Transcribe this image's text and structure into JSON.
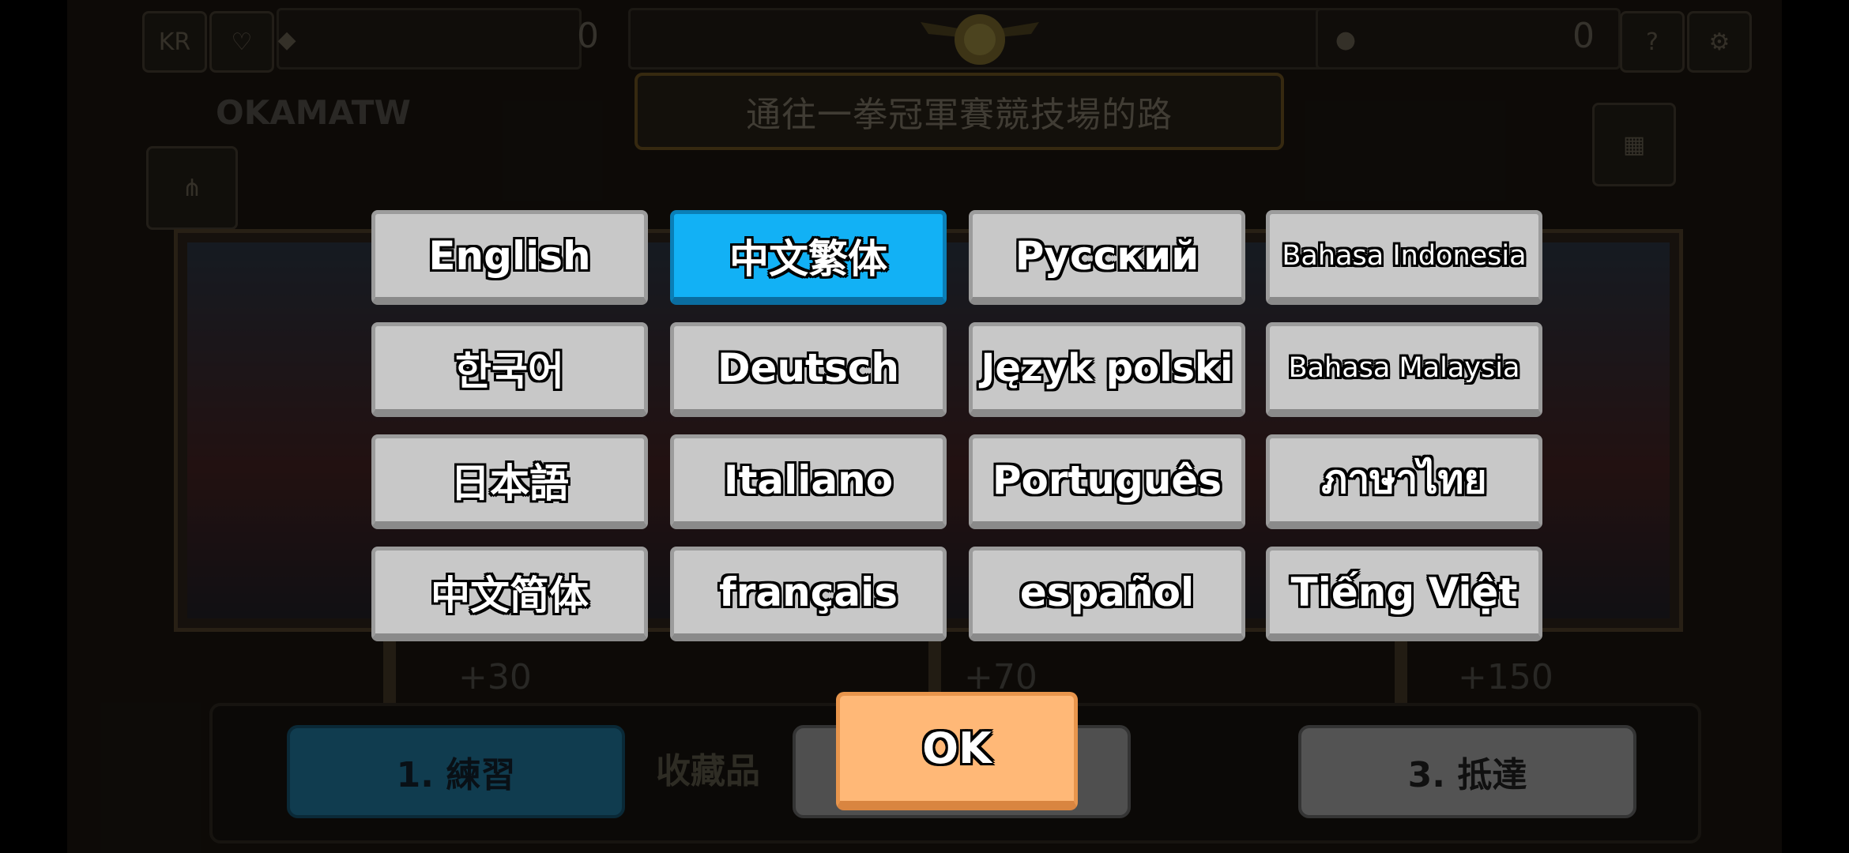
{
  "header": {
    "title_banner": "通往一拳冠軍賽競技場的路",
    "player_name": "OKAMATW",
    "gem_count": "0",
    "coin_count": "0",
    "left_icon_1": "KR"
  },
  "rewards": [
    "+30",
    "+70",
    "+150"
  ],
  "stages": {
    "stage_1": "1. 練習",
    "stage_2_side": "收藏品",
    "stage_3": "3. 抵達"
  },
  "language_dialog": {
    "selected": "中文繁体",
    "languages": [
      "English",
      "中文繁体",
      "Русский",
      "Bahasa Indonesia",
      "한국어",
      "Deutsch",
      "Język polski",
      "Bahasa Malaysia",
      "日本語",
      "Italiano",
      "Português",
      "ภาษาไทย",
      "中文简体",
      "français",
      "español",
      "Tiếng Việt"
    ],
    "ok_label": "OK"
  },
  "colors": {
    "selected_button": "#12b1f5",
    "default_button": "#c8c8c8",
    "ok_button": "#ffb877"
  }
}
